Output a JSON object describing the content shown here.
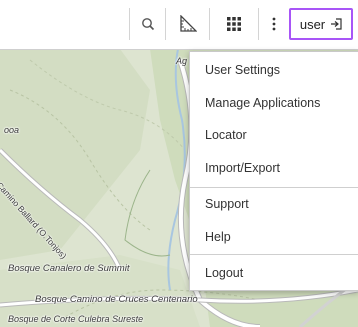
{
  "toolbar": {
    "search_icon": "search-icon",
    "measure_icon": "measure-icon",
    "apps_icon": "apps-grid-icon",
    "more_icon": "more-vertical-icon",
    "user_label": "user",
    "user_icon": "logout-arrow-icon",
    "highlight_color": "#a855f7"
  },
  "user_menu": {
    "items": [
      {
        "label": "User Settings"
      },
      {
        "label": "Manage Applications"
      },
      {
        "label": "Locator"
      },
      {
        "label": "Import/Export"
      },
      {
        "label": "Support"
      },
      {
        "label": "Help"
      },
      {
        "label": "Logout"
      }
    ]
  },
  "map": {
    "labels": [
      "ooa",
      "Camino Ballard (O.Tonjos)",
      "Bosque Canalero de Summit",
      "Bosque Camino de Cruces Centenario",
      "Bosque de Corte Culebra Sureste",
      "Ag"
    ],
    "colors": {
      "land": "#dde4d0",
      "forest": "#c9d9b7",
      "road": "#ffffff",
      "road_outline": "#b9b9b9"
    }
  }
}
